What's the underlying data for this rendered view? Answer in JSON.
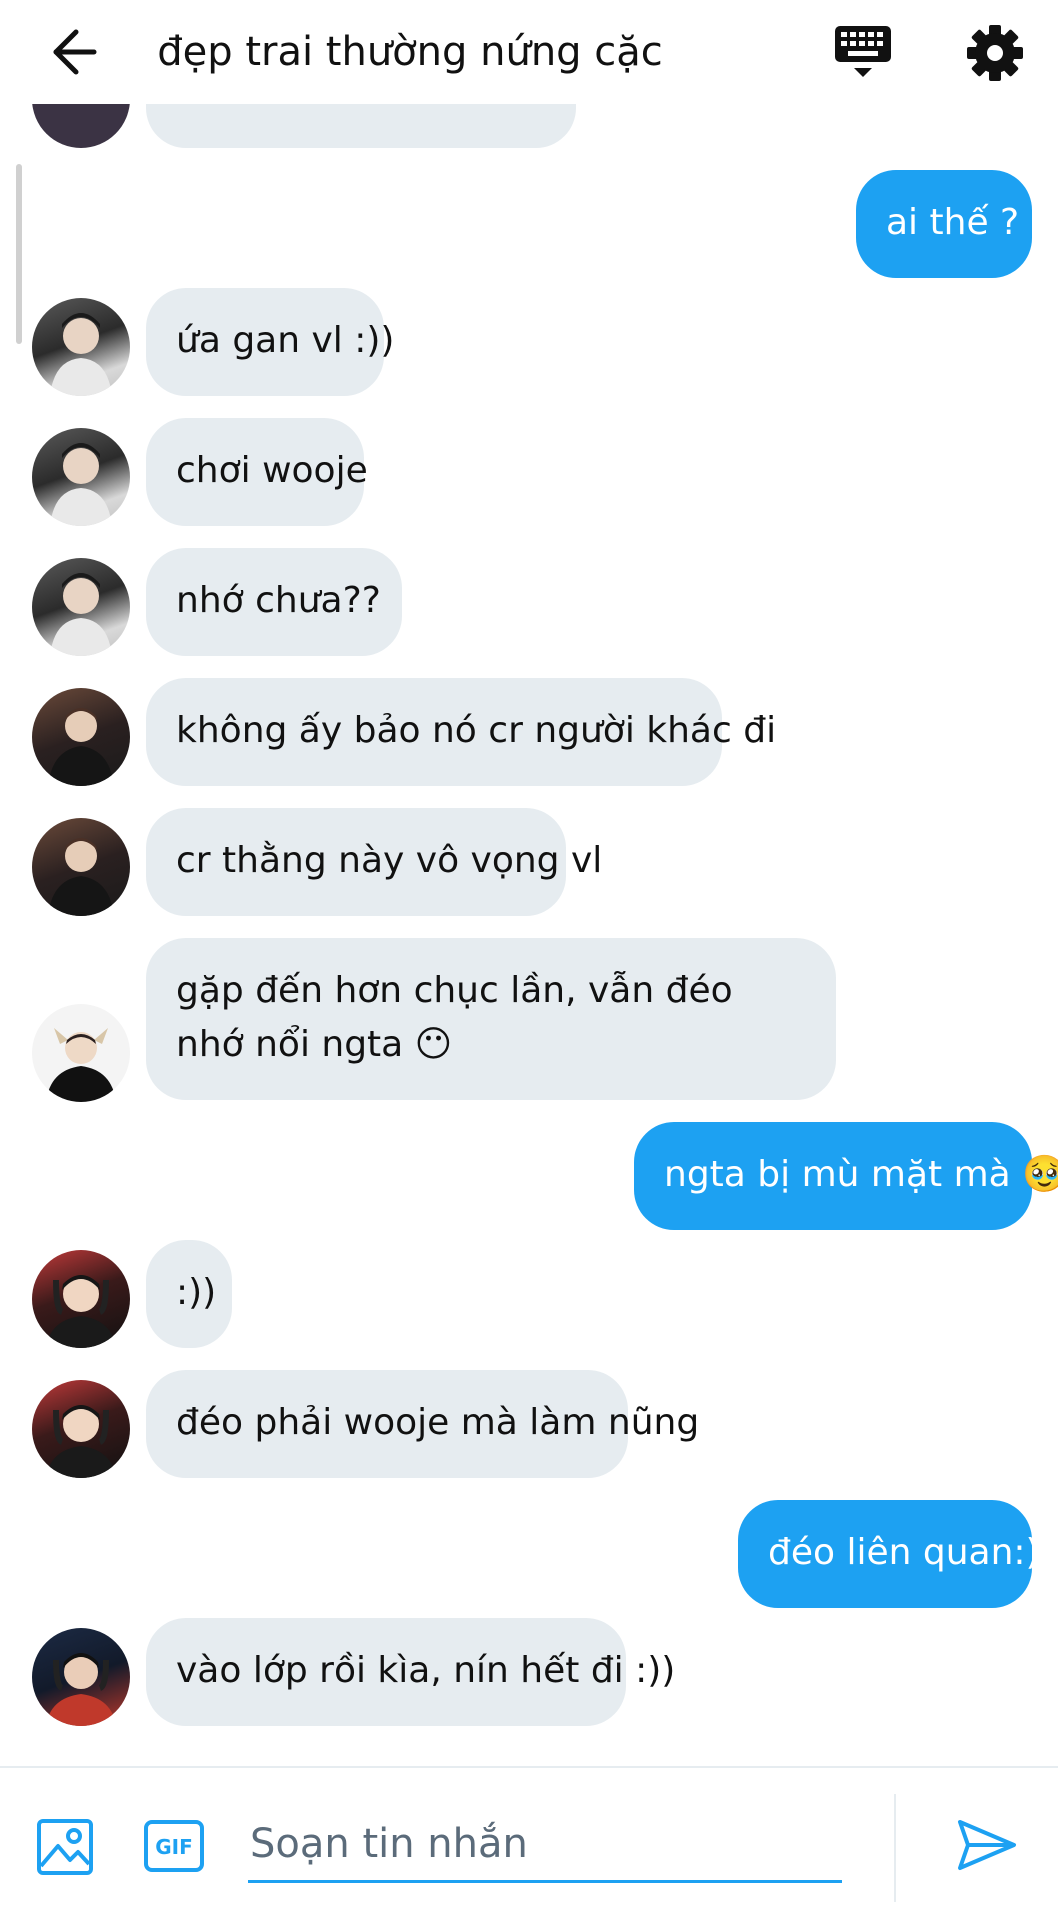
{
  "header": {
    "title": "đẹp trai thường nứng cặc",
    "back_icon": "back-arrow-icon",
    "keyboard_icon": "keyboard-icon",
    "settings_icon": "gear-icon"
  },
  "messages": [
    {
      "side": "in",
      "text": ""
    },
    {
      "side": "out",
      "text": "ai thế ?"
    },
    {
      "side": "in",
      "text": "ứa gan vl :))"
    },
    {
      "side": "in",
      "text": "chơi wooje"
    },
    {
      "side": "in",
      "text": "nhớ chưa??"
    },
    {
      "side": "in",
      "text": "không ấy bảo nó cr người khác đi"
    },
    {
      "side": "in",
      "text": "cr thằng này vô vọng vl"
    },
    {
      "side": "in",
      "text": "gặp đến hơn chục lần, vẫn đéo nhớ nổi ngta 😶"
    },
    {
      "side": "out",
      "text": "ngta bị mù mặt mà 🥹"
    },
    {
      "side": "in",
      "text": ":))"
    },
    {
      "side": "in",
      "text": "đéo phải wooje mà làm nũng"
    },
    {
      "side": "out",
      "text": "đéo liên quan:))"
    },
    {
      "side": "in",
      "text": "vào lớp rồi kìa, nín hết đi :))"
    }
  ],
  "composer": {
    "placeholder": "Soạn tin nhắn",
    "value": "",
    "image_icon": "image-icon",
    "gif_label": "GIF",
    "send_icon": "send-icon"
  },
  "colors": {
    "accent": "#1da1f2",
    "incoming_bubble": "#e6ecf0",
    "outgoing_text": "#ffffff"
  }
}
